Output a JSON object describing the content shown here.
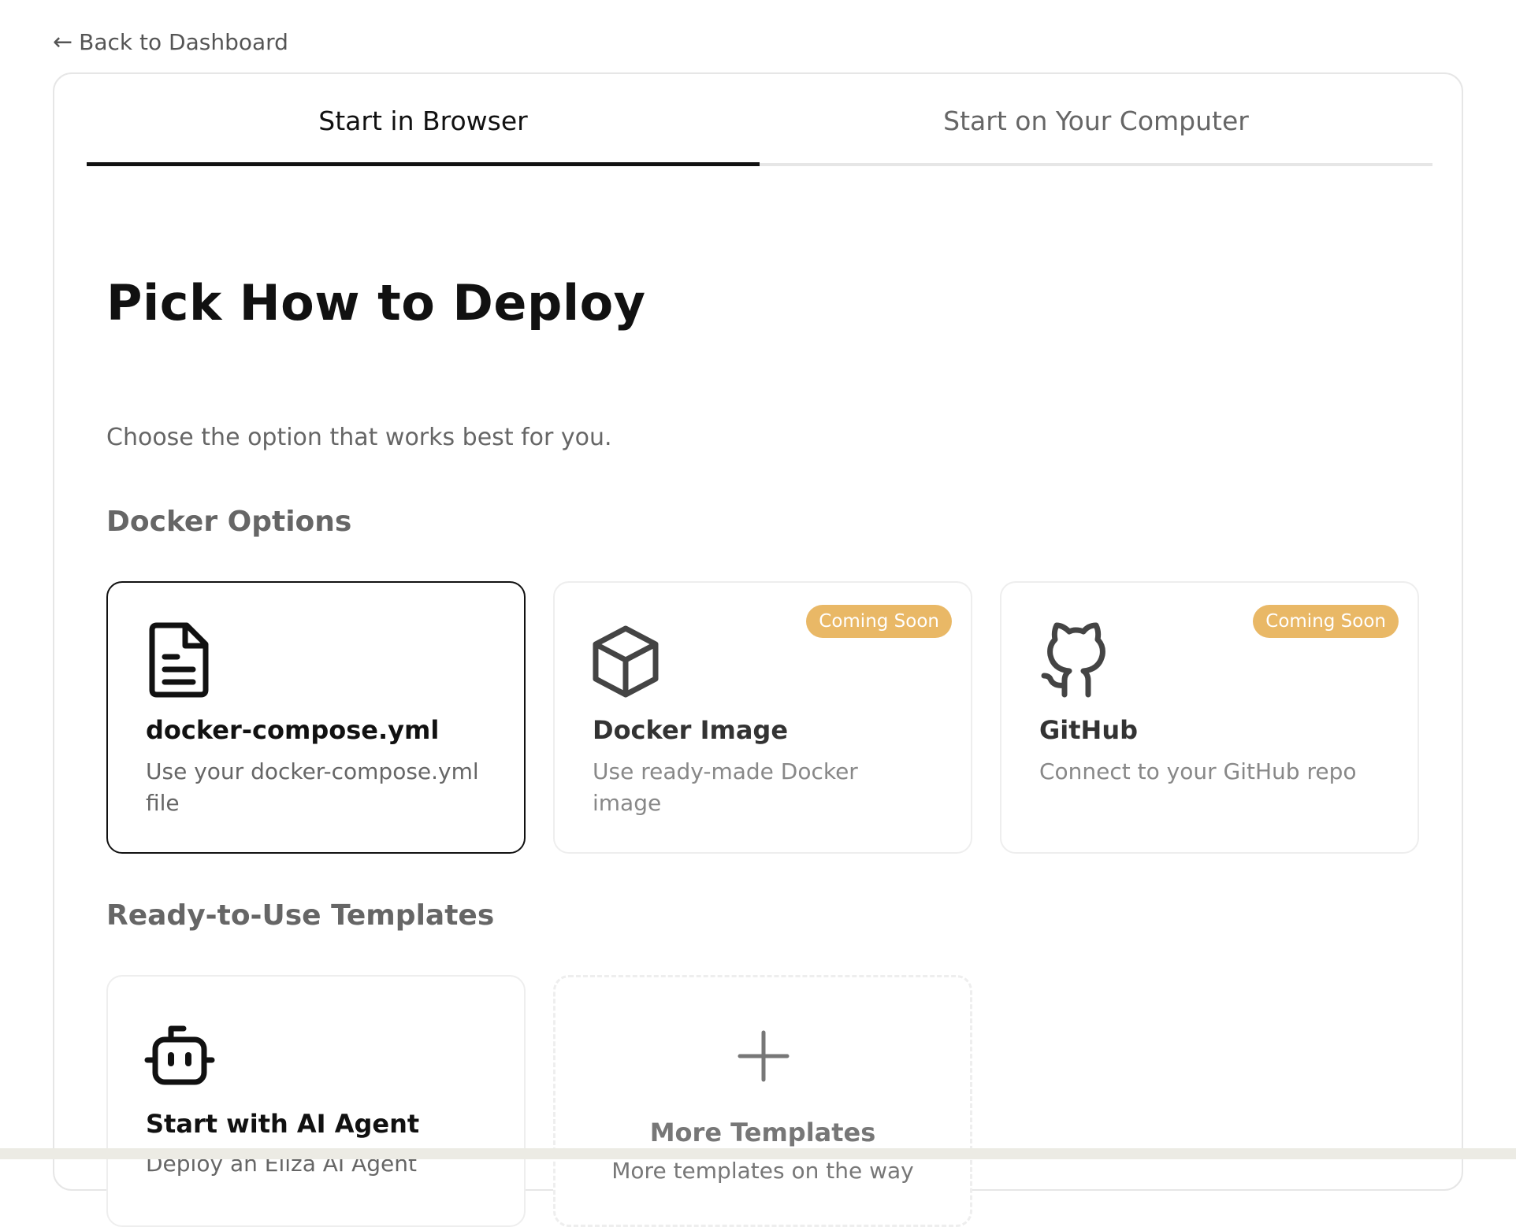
{
  "back_link": {
    "arrow": "←",
    "label": "Back to Dashboard"
  },
  "tabs": [
    {
      "label": "Start in Browser",
      "active": true
    },
    {
      "label": "Start on Your Computer",
      "active": false
    }
  ],
  "main": {
    "title": "Pick How to Deploy",
    "subtitle": "Choose the option that works best for you."
  },
  "docker_section": {
    "title": "Docker Options",
    "cards": [
      {
        "title": "docker-compose.yml",
        "description": "Use your docker-compose.yml file",
        "icon": "document-icon",
        "selected": true,
        "badge": ""
      },
      {
        "title": "Docker Image",
        "description": "Use ready-made Docker image",
        "icon": "cube-icon",
        "selected": false,
        "badge": "Coming Soon"
      },
      {
        "title": "GitHub",
        "description": "Connect to your GitHub repo",
        "icon": "github-icon",
        "selected": false,
        "badge": "Coming Soon"
      }
    ]
  },
  "templates_section": {
    "title": "Ready-to-Use Templates",
    "cards": [
      {
        "title": "Start with AI Agent",
        "description": "Deploy an Eliza AI Agent",
        "icon": "robot-icon"
      },
      {
        "title": "More Templates",
        "description": "More templates on the way",
        "icon": "plus-icon"
      }
    ]
  },
  "colors": {
    "badge": "#e9b866",
    "active_tab_underline": "#111111",
    "muted_text": "#666666",
    "card_border": "#eeeeee"
  }
}
